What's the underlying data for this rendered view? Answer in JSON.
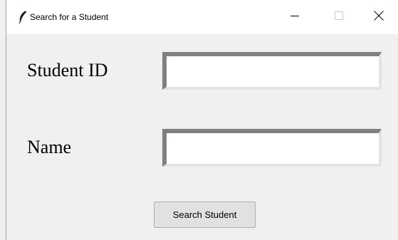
{
  "window": {
    "title": "Search for a Student",
    "app_icon": "feather-icon",
    "controls": {
      "minimize_icon": "minimize-icon",
      "maximize_icon": "maximize-icon",
      "close_icon": "close-icon"
    }
  },
  "form": {
    "student_id": {
      "label": "Student ID",
      "value": ""
    },
    "name": {
      "label": "Name",
      "value": ""
    },
    "search_button_label": "Search Student"
  },
  "colors": {
    "titlebar_bg": "#ffffff",
    "window_bg": "#f0f0f0",
    "entry_bg": "#ffffff",
    "entry_border_dark": "#808080",
    "entry_border_light": "#e3e3e3",
    "button_bg": "#e1e1e1"
  }
}
